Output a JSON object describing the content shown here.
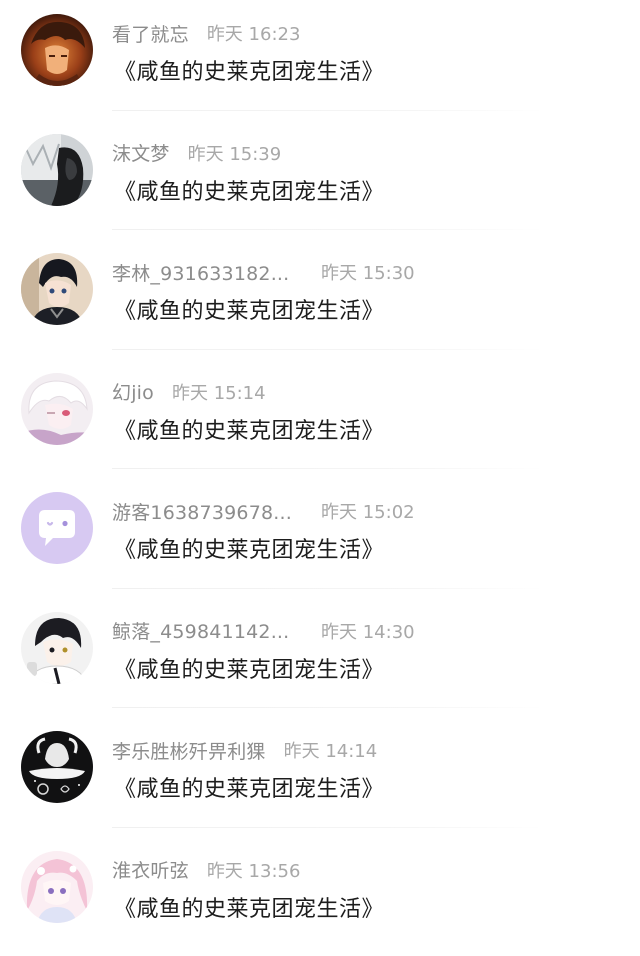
{
  "messages": [
    {
      "name": "看了就忘",
      "time": "昨天 16:23",
      "content": "《咸鱼的史莱克团宠生活》",
      "avatar_icon": "avatar-dark-haired-boy"
    },
    {
      "name": "沫文梦",
      "time": "昨天 15:39",
      "content": "《咸鱼的史莱克团宠生活》",
      "avatar_icon": "avatar-snowy-window-figure"
    },
    {
      "name": "李林_931633182...",
      "time": "昨天 15:30",
      "content": "《咸鱼的史莱克团宠生活》",
      "avatar_icon": "avatar-anime-boy-dark-hair"
    },
    {
      "name": "幻jio",
      "time": "昨天 15:14",
      "content": "《咸鱼的史莱克团宠生活》",
      "avatar_icon": "avatar-white-haired-anime"
    },
    {
      "name": "游客1638739678...",
      "time": "昨天 15:02",
      "content": "《咸鱼的史莱克团宠生活》",
      "avatar_icon": "chat-bubble-icon"
    },
    {
      "name": "鲸落_459841142...",
      "time": "昨天 14:30",
      "content": "《咸鱼的史莱克团宠生活》",
      "avatar_icon": "avatar-anime-boy-school"
    },
    {
      "name": "李乐胜彬歼畀利猓",
      "time": "昨天 14:14",
      "content": "《咸鱼的史莱克团宠生活》",
      "avatar_icon": "avatar-sketch-hands"
    },
    {
      "name": "淮衣听弦",
      "time": "昨天 13:56",
      "content": "《咸鱼的史莱克团宠生活》",
      "avatar_icon": "avatar-pink-haired-girl"
    }
  ],
  "colors": {
    "name_text": "#8c8c8c",
    "time_text": "#a8a8a8",
    "content_text": "#1d1d1d",
    "default_avatar_bg": "#d7c9f2",
    "divider": "#f0f0f0"
  }
}
